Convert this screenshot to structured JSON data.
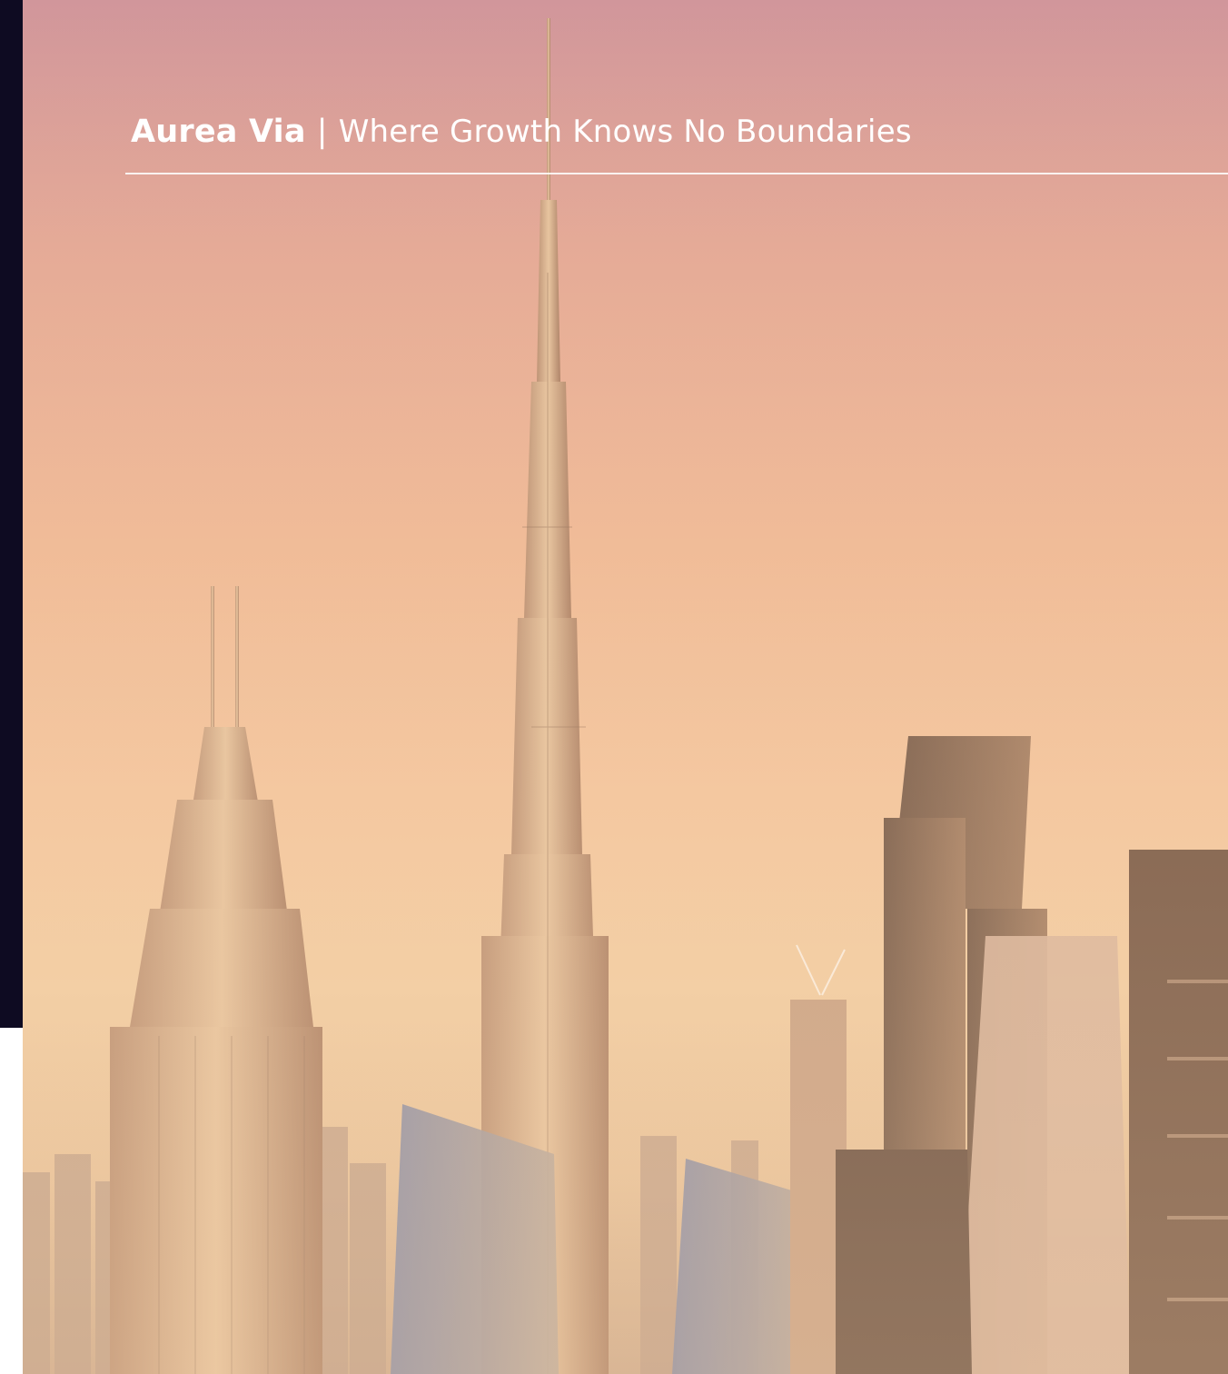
{
  "header": {
    "brand": "Aurea Via",
    "separator": "|",
    "tagline": "Where Growth Knows No Boundaries"
  },
  "hero": {
    "description_icon": "city-skyline-photo"
  },
  "colors": {
    "side_bar": "#0e0b22",
    "sky_top": "#d1969b",
    "sky_bottom": "#f3cfa5",
    "text": "#ffffff"
  }
}
